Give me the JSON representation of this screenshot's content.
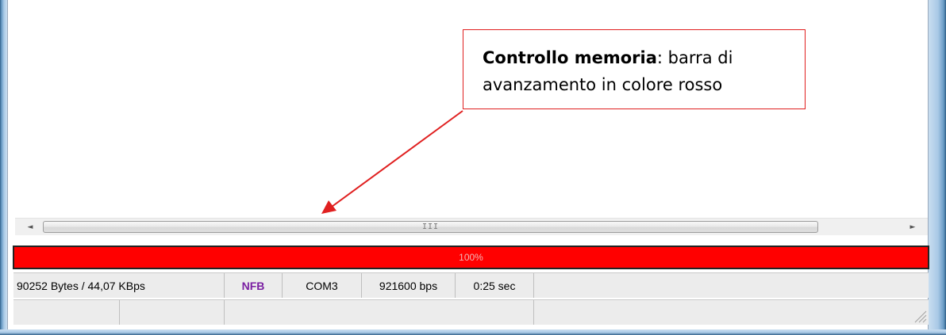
{
  "annotation": {
    "bold_text": "Controllo memoria",
    "rest_line1": ": barra di",
    "line2": "avanzamento in colore rosso"
  },
  "scrollbar": {
    "left_arrow": "◄",
    "right_arrow": "►",
    "grip": "III"
  },
  "progress": {
    "value_percent": 100,
    "label": "100%",
    "fill_color": "#ff0000"
  },
  "status_row1": {
    "transfer": "90252 Bytes / 44,07 KBps",
    "mode": "NFB",
    "port": "COM3",
    "baud": "921600 bps",
    "elapsed": "0:25 sec"
  },
  "colors": {
    "annotation_border": "#e02020",
    "mode_text": "#7a1fa2",
    "frame": "#6a9cc6"
  }
}
